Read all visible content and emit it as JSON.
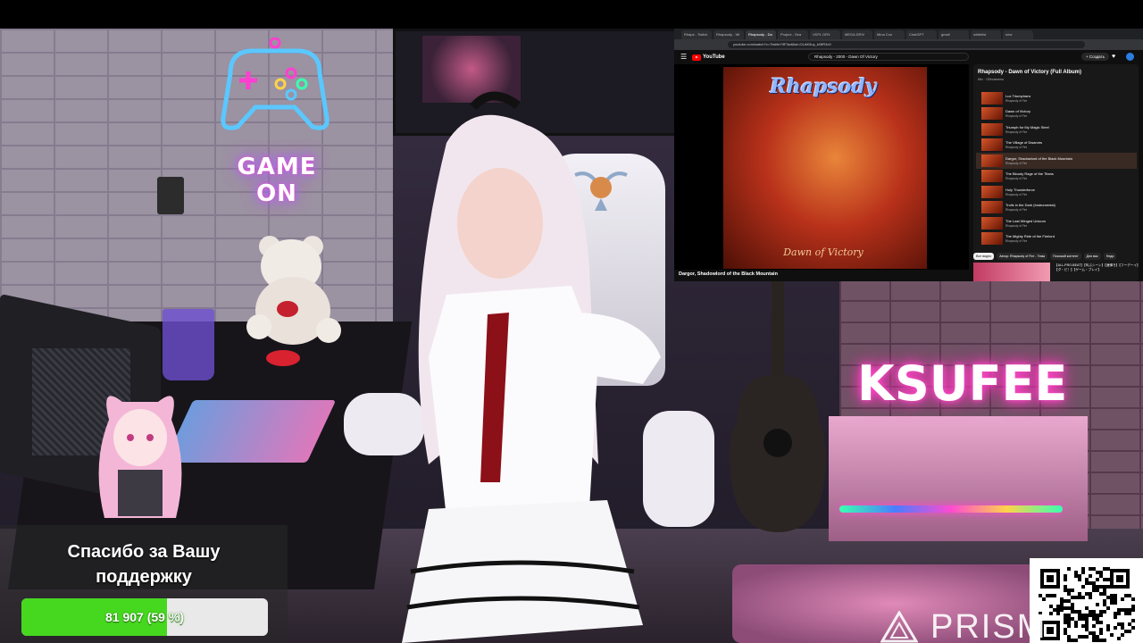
{
  "stream": {
    "neon_sign_left": "GAME ON",
    "neon_sign_right": "KSUFEE",
    "watermark": "PRISM"
  },
  "browser": {
    "tabs": [
      "Rhaps - Twitch",
      "Rhapsody - Wi",
      "Rhapsody - Da",
      "Project - Sea",
      "VKPL DRX",
      "MEGA DRIV",
      "Mina Con",
      "ChatGPT",
      "gmail",
      "whitelist",
      "new"
    ],
    "url": "youtube.com/watch?v=7fabfnY9F3w&list=OLAK5uy_kI3fR3x9",
    "youtube": {
      "logo_text": "YouTube",
      "search_value": "Rhapsody - 2000 - Dawn Of Victory",
      "create_label": "+ Создать",
      "now_playing_title": "Dargor, Shadowlord of the Black Mountain",
      "album_logo": "Rhapsody",
      "album_subtitle": "Dawn of Victory",
      "playlist": {
        "title": "Rhapsody - Dawn of Victory (Full Album)",
        "meta": "Mix · Обновлено",
        "items": [
          {
            "title": "Lux Triumphans",
            "channel": "Rhapsody of Fire"
          },
          {
            "title": "Dawn of Victory",
            "channel": "Rhapsody of Fire"
          },
          {
            "title": "Triumph for My Magic Steel",
            "channel": "Rhapsody of Fire"
          },
          {
            "title": "The Village of Dwarves",
            "channel": "Rhapsody of Fire"
          },
          {
            "title": "Dargor, Shadowlord of the Black Mountain",
            "channel": "Rhapsody of Fire",
            "active": true
          },
          {
            "title": "The Bloody Rage of the Titans",
            "channel": "Rhapsody of Fire"
          },
          {
            "title": "Holy Thunderforce",
            "channel": "Rhapsody of Fire"
          },
          {
            "title": "Trolls in the Dark (Instrumental)",
            "channel": "Rhapsody of Fire"
          },
          {
            "title": "The Last Winged Unicorn",
            "channel": "Rhapsody of Fire"
          },
          {
            "title": "The Mighty Ride of the Firelord",
            "channel": "Rhapsody of Fire"
          }
        ]
      },
      "chips": [
        "Все видео",
        "Автор: Rhapsody of Fire - Тема",
        "Похожий контент",
        "Для вас",
        "Неди"
      ],
      "recommended_text": "【ALL-PRO-BEAT】【叫ぶシーン】【速弾き】【フーデーイ】【ダ・ピ！】【ゲーム・プレイ】"
    }
  },
  "donation": {
    "message_line1": "Спасибо за Вашу",
    "message_line2": "поддержку",
    "amount_label": "81 907 (59 %)",
    "progress_fraction": 0.59,
    "fill_color": "#46d81f"
  }
}
